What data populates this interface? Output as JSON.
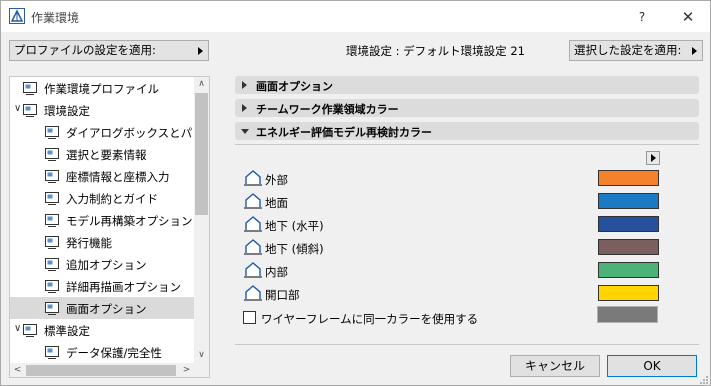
{
  "window": {
    "title": "作業環境",
    "help_label": "?",
    "close_label": "✕"
  },
  "toolbar": {
    "profile_button": "プロファイルの設定を適用:",
    "environment_label": "環境設定 : デフォルト環境設定 21",
    "selected_button": "選択した設定を適用:"
  },
  "tree": {
    "items": [
      {
        "label": "作業環境プロファイル",
        "icon": "profile-icon",
        "indent": 0,
        "chevron": ""
      },
      {
        "label": "環境設定",
        "icon": "environment-settings-icon",
        "indent": 0,
        "chevron": "∨"
      },
      {
        "label": "ダイアログボックスとパレット",
        "icon": "dialog-palette-icon",
        "indent": 1,
        "chevron": ""
      },
      {
        "label": "選択と要素情報",
        "icon": "selection-info-icon",
        "indent": 1,
        "chevron": ""
      },
      {
        "label": "座標情報と座標入力",
        "icon": "xyz-coordinates-icon",
        "indent": 1,
        "chevron": ""
      },
      {
        "label": "入力制約とガイド",
        "icon": "mouse-icon",
        "indent": 1,
        "chevron": ""
      },
      {
        "label": "モデル再構築オプション",
        "icon": "model-rebuild-icon",
        "indent": 1,
        "chevron": ""
      },
      {
        "label": "発行機能",
        "icon": "publish-icon",
        "indent": 1,
        "chevron": ""
      },
      {
        "label": "追加オプション",
        "icon": "sliders-icon",
        "indent": 1,
        "chevron": ""
      },
      {
        "label": "詳細再描画オプション",
        "icon": "redraw-icon",
        "indent": 1,
        "chevron": ""
      },
      {
        "label": "画面オプション",
        "icon": "monitor-icon",
        "indent": 1,
        "chevron": "",
        "selected": true
      },
      {
        "label": "標準設定",
        "icon": "standard-settings-icon",
        "indent": 0,
        "chevron": "∨"
      },
      {
        "label": "データ保護/完全性",
        "icon": "data-protection-icon",
        "indent": 1,
        "chevron": ""
      }
    ],
    "scroll_up": "∧",
    "scroll_down": "∨",
    "scroll_left": "<",
    "scroll_right": ">"
  },
  "sections": [
    {
      "label": "画面オプション",
      "expanded": false
    },
    {
      "label": "チームワーク作業領域カラー",
      "expanded": false
    },
    {
      "label": "エネルギー評価モデル再検討カラー",
      "expanded": true
    }
  ],
  "zones": [
    {
      "label": "外部",
      "icon": "exterior-zone-icon",
      "color": "#f5822a"
    },
    {
      "label": "地面",
      "icon": "ground-zone-icon",
      "color": "#1b7ac4"
    },
    {
      "label": "地下 (水平)",
      "icon": "underground-horizontal-icon",
      "color": "#24509c"
    },
    {
      "label": "地下 (傾斜)",
      "icon": "underground-sloped-icon",
      "color": "#7a5f5e"
    },
    {
      "label": "内部",
      "icon": "interior-zone-icon",
      "color": "#4db278"
    },
    {
      "label": "開口部",
      "icon": "opening-zone-icon",
      "color": "#ffd400"
    }
  ],
  "wireframe": {
    "label": "ワイヤーフレームに同一カラーを使用する",
    "checked": false,
    "color": "#7a7a7a"
  },
  "buttons": {
    "cancel": "キャンセル",
    "ok": "OK"
  }
}
